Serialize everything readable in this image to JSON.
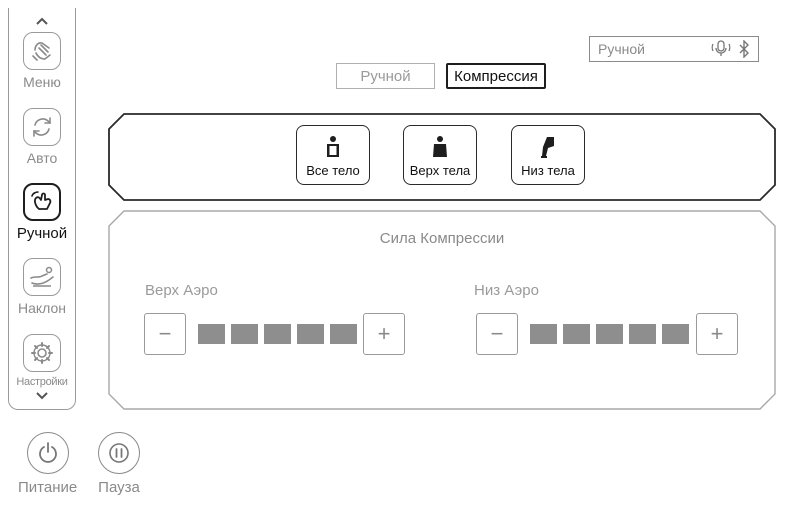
{
  "sidebar": {
    "items": [
      {
        "key": "menu",
        "label": "Меню",
        "icon": "hand-icon",
        "active": false
      },
      {
        "key": "auto",
        "label": "Авто",
        "icon": "refresh-icon",
        "active": false
      },
      {
        "key": "manual",
        "label": "Ручной",
        "icon": "touch-hand-icon",
        "active": true
      },
      {
        "key": "recline",
        "label": "Наклон",
        "icon": "recline-chair-icon",
        "active": false
      },
      {
        "key": "settings",
        "label": "Настройки",
        "icon": "gear-icon",
        "active": false
      }
    ]
  },
  "bottom": {
    "power_label": "Питание",
    "pause_label": "Пауза"
  },
  "status": {
    "mode_label": "Ручной",
    "icons": [
      "microphone-icon",
      "bluetooth-icon"
    ]
  },
  "tabs": {
    "manual": "Ручной",
    "compression": "Компрессия",
    "active": "compression"
  },
  "areas": [
    {
      "key": "full",
      "label": "Все тело",
      "icon": "full-body-icon"
    },
    {
      "key": "upper",
      "label": "Верх тела",
      "icon": "upper-body-icon"
    },
    {
      "key": "lower",
      "label": "Низ тела",
      "icon": "legs-icon"
    }
  ],
  "compression": {
    "title": "Сила Компрессии",
    "upper": {
      "label": "Верх Аэро",
      "level": 5,
      "max": 5
    },
    "lower": {
      "label": "Низ Аэро",
      "level": 5,
      "max": 5
    },
    "minus": "−",
    "plus": "+"
  },
  "colors": {
    "active_border": "#1e1e1e",
    "inactive": "#9a9a9a",
    "level_fill": "#8e8e8e"
  }
}
